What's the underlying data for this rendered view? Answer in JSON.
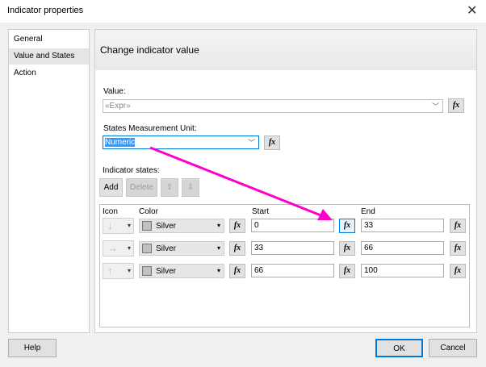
{
  "window": {
    "title": "Indicator properties",
    "close": "✕"
  },
  "nav": {
    "items": [
      {
        "label": "General"
      },
      {
        "label": "Value and States",
        "selected": true
      },
      {
        "label": "Action"
      }
    ]
  },
  "main": {
    "heading": "Change indicator value",
    "value_label": "Value:",
    "value_placeholder": "«Expr»",
    "unit_label": "States Measurement Unit:",
    "unit_value": "Numeric",
    "states_label": "Indicator states:",
    "buttons": {
      "add": "Add",
      "delete": "Delete",
      "up": "⇧",
      "down": "⇩"
    },
    "fx": "fx",
    "columns": {
      "icon": "Icon",
      "color": "Color",
      "start": "Start",
      "end": "End"
    },
    "rows": [
      {
        "icon": "↓",
        "icon_name": "arrow-down-icon",
        "color": "Silver",
        "start": "0",
        "end": "33"
      },
      {
        "icon": "→",
        "icon_name": "arrow-right-icon",
        "color": "Silver",
        "start": "33",
        "end": "66"
      },
      {
        "icon": "↑",
        "icon_name": "arrow-up-icon",
        "color": "Silver",
        "start": "66",
        "end": "100"
      }
    ]
  },
  "footer": {
    "help": "Help",
    "ok": "OK",
    "cancel": "Cancel"
  },
  "colors": {
    "annotation_arrow": "#ff00cc",
    "selection": "#3399ff",
    "silver": "#c0c0c0"
  }
}
